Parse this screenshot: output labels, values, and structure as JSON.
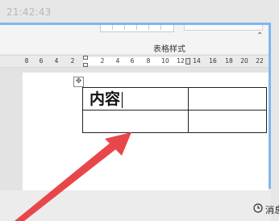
{
  "timestamp": "21:42:43",
  "ribbon": {
    "group_label": "表格样式"
  },
  "ruler": {
    "ticks": [
      "8",
      "6",
      "4",
      "2",
      "2",
      "4",
      "6",
      "8",
      "10",
      "12",
      "14",
      "16",
      "18",
      "20",
      "22"
    ]
  },
  "document": {
    "table": {
      "rows": [
        [
          "内容",
          ""
        ],
        [
          "",
          ""
        ]
      ]
    }
  },
  "status_bar": {
    "cancel_label": "消息"
  },
  "colors": {
    "frame": "#7fb7f0",
    "arrow": "#e8474a"
  },
  "icons": {
    "move_handle": "table-move-handle-icon",
    "clock": "clock-icon"
  }
}
